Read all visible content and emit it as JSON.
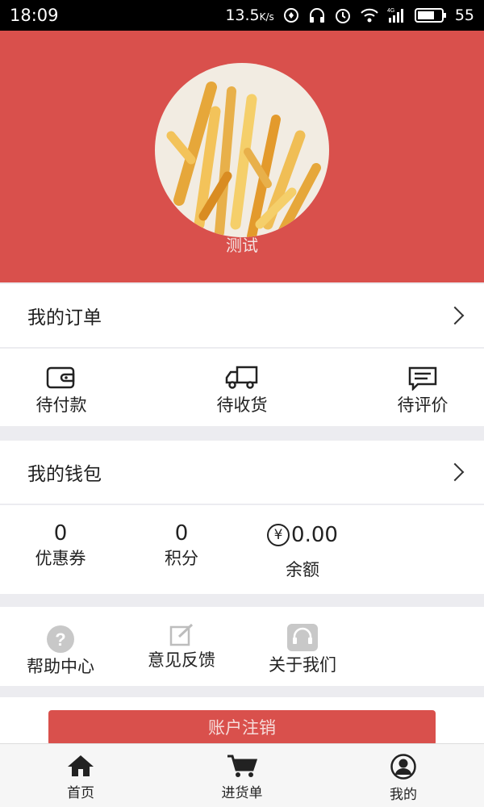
{
  "status_bar": {
    "time": "18:09",
    "network_speed": "13.5",
    "speed_unit": "K/s",
    "battery": "55",
    "signal_label": "4G"
  },
  "profile": {
    "username": "测试"
  },
  "orders": {
    "title": "我的订单",
    "items": [
      {
        "label": "待付款",
        "icon": "wallet-icon"
      },
      {
        "label": "待收货",
        "icon": "truck-icon"
      },
      {
        "label": "待评价",
        "icon": "comment-icon"
      }
    ]
  },
  "wallet": {
    "title": "我的钱包",
    "items": [
      {
        "value": "0",
        "label": "优惠券"
      },
      {
        "value": "0",
        "label": "积分"
      },
      {
        "value": "0.00",
        "label": "余额",
        "currency_symbol": "¥"
      }
    ]
  },
  "services": [
    {
      "label": "帮助中心",
      "icon": "help-icon"
    },
    {
      "label": "意见反馈",
      "icon": "feedback-icon"
    },
    {
      "label": "关于我们",
      "icon": "headset-icon"
    }
  ],
  "logout": {
    "label": "账户注销"
  },
  "tabbar": [
    {
      "label": "首页",
      "icon": "home-icon"
    },
    {
      "label": "进货单",
      "icon": "cart-icon"
    },
    {
      "label": "我的",
      "icon": "user-icon"
    }
  ],
  "colors": {
    "accent": "#d9504c",
    "background": "#ececf0"
  }
}
